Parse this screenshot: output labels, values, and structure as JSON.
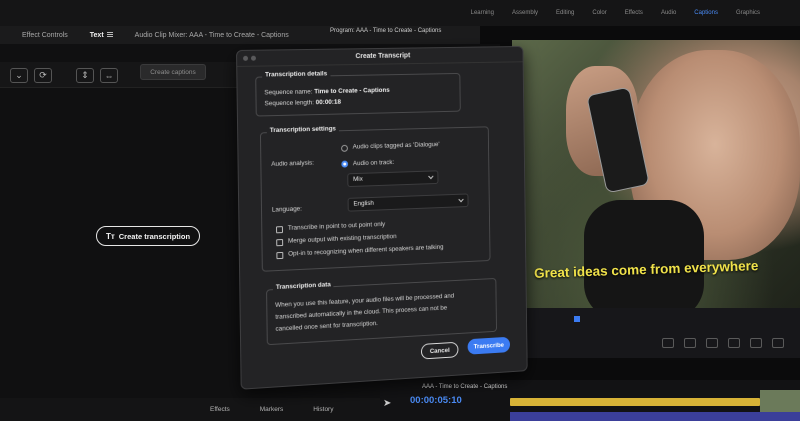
{
  "workspaces": [
    "Learning",
    "Assembly",
    "Editing",
    "Color",
    "Effects",
    "Audio",
    "Captions",
    "Graphics"
  ],
  "panel_tabs": {
    "effect_controls": "Effect Controls",
    "text": "Text",
    "audio_clip_mixer": "Audio Clip Mixer: AAA - Time to Create - Captions"
  },
  "program_label": "Program: AAA - Time to Create - Captions",
  "text_panel": {
    "create_captions": "Create captions",
    "create_transcription": "Create transcription",
    "create_transcription_icon": "Tт"
  },
  "bottom_tabs": [
    "Effects",
    "Markers",
    "History"
  ],
  "video": {
    "caption": "Great ideas come from everywhere"
  },
  "timeline": {
    "sequence_name": "AAA - Time to Create - Captions",
    "timecode": "00:00:05:10"
  },
  "dialog": {
    "title": "Create Transcript",
    "details": {
      "heading": "Transcription details",
      "sequence_name_label": "Sequence name:",
      "sequence_name_value": "Time to Create - Captions",
      "sequence_length_label": "Sequence length:",
      "sequence_length_value": "00:00:18"
    },
    "settings": {
      "heading": "Transcription settings",
      "audio_analysis_label": "Audio analysis:",
      "option_dialogue": "Audio clips tagged as 'Dialogue'",
      "option_track": "Audio on track:",
      "track_value": "Mix",
      "language_label": "Language:",
      "language_value": "English",
      "check_in_out": "Transcribe in point to out point only",
      "check_merge": "Merge output with existing transcription",
      "check_speakers": "Opt-in to recognizing when different speakers are talking"
    },
    "data": {
      "heading": "Transcription data",
      "line1": "When you use this feature, your audio files will be processed and",
      "line2": "transcribed automatically in the cloud. This process can not be",
      "line3": "cancelled once sent for transcription."
    },
    "cancel": "Cancel",
    "transcribe": "Transcribe"
  },
  "colors": {
    "accent": "#3b7bf2",
    "caption": "#f0e24a",
    "dialog_bg": "#232325"
  }
}
